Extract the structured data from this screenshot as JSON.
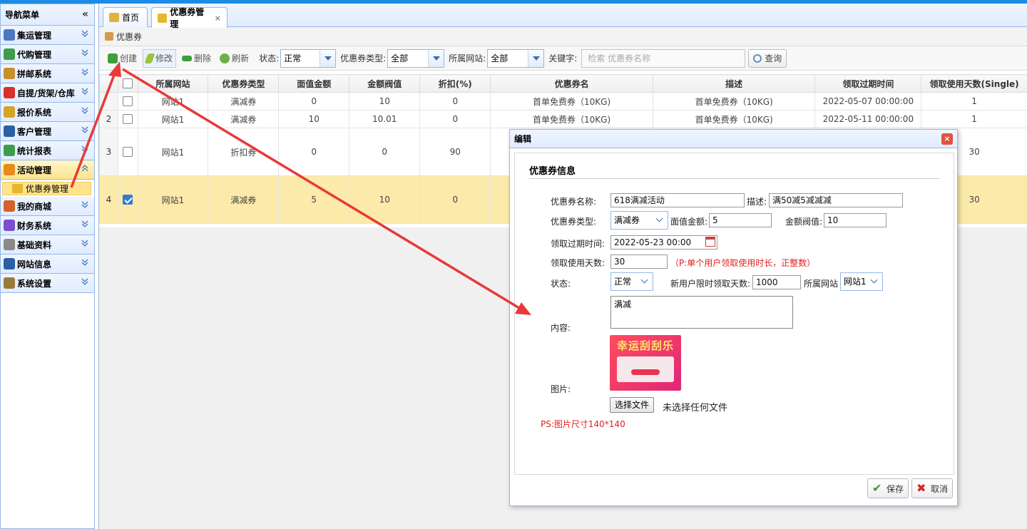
{
  "sidebar": {
    "title": "导航菜单",
    "collapse_glyph": "«",
    "items": [
      {
        "label": "集运管理",
        "icon": "monitor-icon",
        "color": "#4a78c2"
      },
      {
        "label": "代购管理",
        "icon": "globe-icon",
        "color": "#3f9c4a"
      },
      {
        "label": "拼邮系统",
        "icon": "box-icon",
        "color": "#c8902a"
      },
      {
        "label": "自提/货架/仓库",
        "icon": "red-ball-icon",
        "color": "#d9302a"
      },
      {
        "label": "报价系统",
        "icon": "coins-icon",
        "color": "#d4a427"
      },
      {
        "label": "客户管理",
        "icon": "user-icon",
        "color": "#2b5fa6"
      },
      {
        "label": "统计报表",
        "icon": "globe-icon",
        "color": "#3f9c4a"
      },
      {
        "label": "活动管理",
        "icon": "rainbow-icon",
        "color": "#e88a1c",
        "active": true
      },
      {
        "label": "我的商城",
        "icon": "ball-icon",
        "color": "#d4602a"
      },
      {
        "label": "财务系统",
        "icon": "color-wheel-icon",
        "color": "#7a4fd0"
      },
      {
        "label": "基础资料",
        "icon": "stack-icon",
        "color": "#8a8a8a"
      },
      {
        "label": "网站信息",
        "icon": "text-icon",
        "color": "#2b5fa6"
      },
      {
        "label": "系统设置",
        "icon": "wrench-icon",
        "color": "#9a7a3a"
      }
    ],
    "sub_item": "优惠券管理"
  },
  "tabs": [
    {
      "label": "首页",
      "icon": "pen-icon"
    },
    {
      "label": "优惠券管理",
      "icon": "crown-icon",
      "close": "×"
    }
  ],
  "panel_title": "优惠券",
  "toolbar": {
    "create": "创建",
    "edit": "修改",
    "delete": "删除",
    "refresh": "刷新",
    "status_label": "状态:",
    "status_value": "正常",
    "type_label": "优惠券类型:",
    "type_value": "全部",
    "site_label": "所属网站:",
    "site_value": "全部",
    "keyword_label": "关键字:",
    "keyword_placeholder": "检索 优惠券名称",
    "query": "查询"
  },
  "table": {
    "columns": [
      "所属网站",
      "优惠券类型",
      "面值金额",
      "金额阀值",
      "折扣(%)",
      "优惠券名",
      "描述",
      "领取过期时间",
      "领取使用天数(Single)"
    ],
    "rows": [
      {
        "num": "",
        "checked": false,
        "site": "网站1",
        "type": "满减券",
        "face": "0",
        "threshold": "10",
        "discount": "0",
        "name": "首单免费券（10KG)",
        "desc": "首单免费券（10KG)",
        "expire": "2022-05-07 00:00:00",
        "days": "1"
      },
      {
        "num": "2",
        "checked": false,
        "site": "网站1",
        "type": "满减券",
        "face": "10",
        "threshold": "10.01",
        "discount": "0",
        "name": "首单免费券（10KG)",
        "desc": "首单免费券（10KG)",
        "expire": "2022-05-11 00:00:00",
        "days": "1"
      },
      {
        "num": "3",
        "checked": false,
        "site": "网站1",
        "type": "折扣券",
        "face": "0",
        "threshold": "0",
        "discount": "90",
        "name": "",
        "desc": "",
        "expire": "",
        "days": "30"
      },
      {
        "num": "4",
        "checked": true,
        "site": "网站1",
        "type": "满减券",
        "face": "5",
        "threshold": "10",
        "discount": "0",
        "name": "",
        "desc": "",
        "expire": "",
        "days": "30"
      }
    ]
  },
  "dialog": {
    "title": "编辑",
    "close": "×",
    "section": "优惠券信息",
    "name_label": "优惠券名称:",
    "name_value": "618满减活动",
    "desc_label": "描述:",
    "desc_value": "满50减5减减减",
    "type_label": "优惠券类型:",
    "type_value": "满减券",
    "face_label": "面值金额:",
    "face_value": "5",
    "threshold_label": "金额阀值:",
    "threshold_value": "10",
    "expire_label": "领取过期时间:",
    "expire_value": "2022-05-23 00:00",
    "days_label": "领取使用天数:",
    "days_value": "30",
    "days_note": "（P:单个用户领取使用时长，正整数）",
    "status_label": "状态:",
    "status_value": "正常",
    "newuser_label": "新用户限时领取天数:",
    "newuser_value": "1000",
    "site_label": "所属网站",
    "site_value": "网站1",
    "content_label": "内容:",
    "content_value": "满减",
    "image_label": "图片:",
    "promo_text": "幸运刮刮乐",
    "file_button": "选择文件",
    "file_status": "未选择任何文件",
    "ps_note": "PS:图片尺寸140*140",
    "save": "保存",
    "cancel": "取消"
  },
  "colors": {
    "accent": "#1c8be6",
    "border": "#95b8e7",
    "selected_row": "#fbeaa9",
    "annotation_arrow": "#e83a3a"
  }
}
